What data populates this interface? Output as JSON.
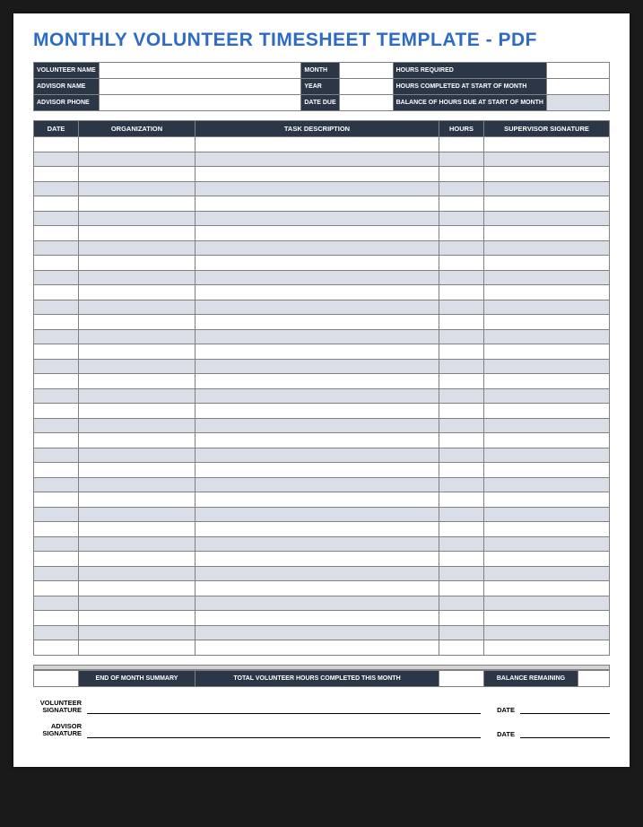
{
  "title": "MONTHLY VOLUNTEER TIMESHEET TEMPLATE - PDF",
  "info": {
    "volunteer_name_lbl": "VOLUNTEER NAME",
    "advisor_name_lbl": "ADVISOR NAME",
    "advisor_phone_lbl": "ADVISOR PHONE",
    "month_lbl": "MONTH",
    "year_lbl": "YEAR",
    "date_due_lbl": "DATE DUE",
    "hours_required_lbl": "HOURS REQUIRED",
    "hours_completed_lbl": "HOURS COMPLETED AT START OF MONTH",
    "balance_due_lbl": "BALANCE OF HOURS DUE AT START OF MONTH"
  },
  "columns": {
    "date": "DATE",
    "organization": "ORGANIZATION",
    "task": "TASK DESCRIPTION",
    "hours": "HOURS",
    "signature": "SUPERVISOR SIGNATURE"
  },
  "row_count": 35,
  "summary": {
    "eom": "END OF MONTH SUMMARY",
    "total_hours": "TOTAL VOLUNTEER HOURS COMPLETED THIS MONTH",
    "balance_remaining": "BALANCE REMAINING"
  },
  "sign": {
    "vol_sig": "VOLUNTEER SIGNATURE",
    "adv_sig": "ADVISOR SIGNATURE",
    "date": "DATE"
  }
}
